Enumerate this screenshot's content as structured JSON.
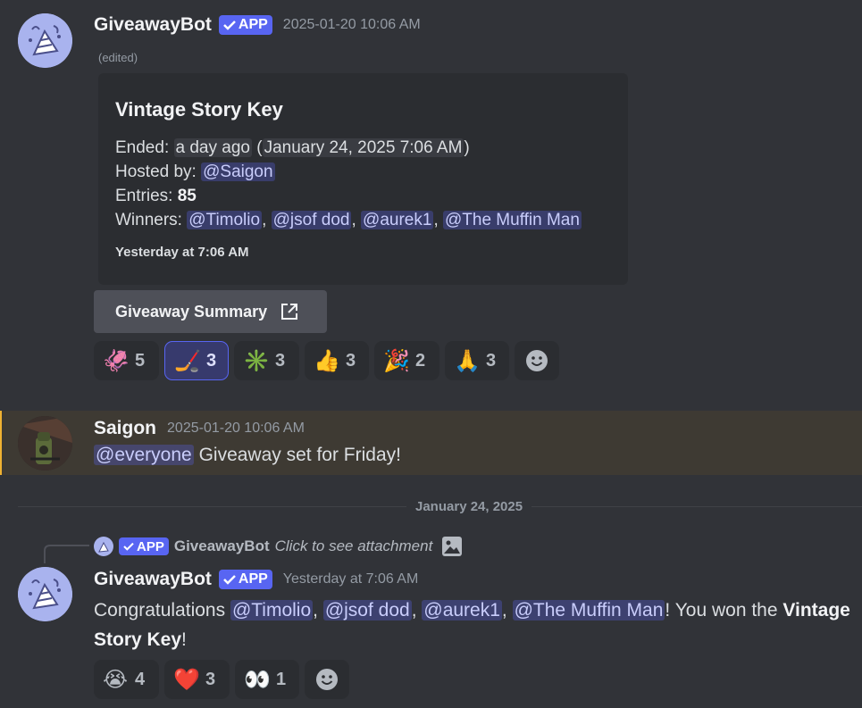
{
  "msg1": {
    "username": "GiveawayBot",
    "app_tag": "APP",
    "timestamp": "2025-01-20 10:06 AM",
    "edited": "(edited)",
    "embed": {
      "title": "Vintage Story Key",
      "ended_label": "Ended:",
      "ended_relative": "a day ago",
      "ended_date": "January 24, 2025 7:06 AM",
      "hosted_label": "Hosted by:",
      "host": "@Saigon",
      "entries_label": "Entries:",
      "entries": "85",
      "winners_label": "Winners:",
      "winners": [
        "@Timolio",
        "@jsof dod",
        "@aurek1",
        "@The Muffin Man"
      ],
      "footer": "Yesterday at 7:06 AM"
    },
    "summary_button": "Giveaway Summary",
    "reactions": [
      {
        "emoji": "🦑",
        "count": "5"
      },
      {
        "emoji": "🏒",
        "count": "3"
      },
      {
        "emoji": "✳️",
        "count": "3"
      },
      {
        "emoji": "👍",
        "count": "3"
      },
      {
        "emoji": "🎉",
        "count": "2"
      },
      {
        "emoji": "🙏",
        "count": "3"
      }
    ]
  },
  "msg2": {
    "username": "Saigon",
    "timestamp": "2025-01-20 10:06 AM",
    "mention": "@everyone",
    "text": "Giveaway set for Friday!"
  },
  "divider": "January 24, 2025",
  "msg3": {
    "reply_app_tag": "APP",
    "reply_username": "GiveawayBot",
    "reply_text": "Click to see attachment",
    "username": "GiveawayBot",
    "app_tag": "APP",
    "timestamp": "Yesterday at 7:06 AM",
    "text_prefix": "Congratulations",
    "mentions": [
      "@Timolio",
      "@jsof dod",
      "@aurek1",
      "@The Muffin Man"
    ],
    "text_suffix": "! You won the",
    "prize": "Vintage Story Key",
    "end": "!",
    "reactions": [
      {
        "emoji": "😭",
        "count": "4"
      },
      {
        "emoji": "❤️",
        "count": "3"
      },
      {
        "emoji": "👀",
        "count": "1"
      }
    ]
  },
  "colors": {
    "background": "#313338",
    "embed": "#2b2d31",
    "highlight": "#3f3c34",
    "accent": "#5865f2"
  }
}
